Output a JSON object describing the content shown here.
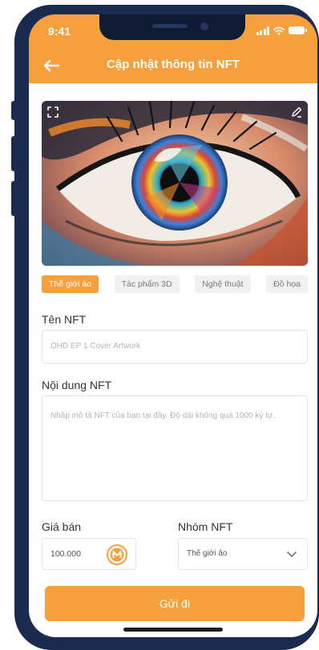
{
  "status_bar": {
    "time": "9:41"
  },
  "header": {
    "title": "Cập nhật thông tin NFT"
  },
  "categories": [
    {
      "label": "Thế giới ảo",
      "active": true
    },
    {
      "label": "Tác phẩm 3D",
      "active": false
    },
    {
      "label": "Nghệ thuật",
      "active": false
    },
    {
      "label": "Đồ họa",
      "active": false
    }
  ],
  "form": {
    "name_label": "Tên NFT",
    "name_placeholder": "OHD EP 1 Cover Artwork",
    "content_label": "Nội dung NFT",
    "content_placeholder": "Nhập mô tả NFT của bạn tại đây. Độ dài không quá 1000 ký tự.",
    "price_label": "Giá bán",
    "price_value": "100.000",
    "group_label": "Nhóm NFT",
    "group_value": "Thế giới ảo",
    "submit_label": "Gửi đi"
  },
  "colors": {
    "accent": "#f5a03c",
    "frame": "#1b2a4f"
  }
}
